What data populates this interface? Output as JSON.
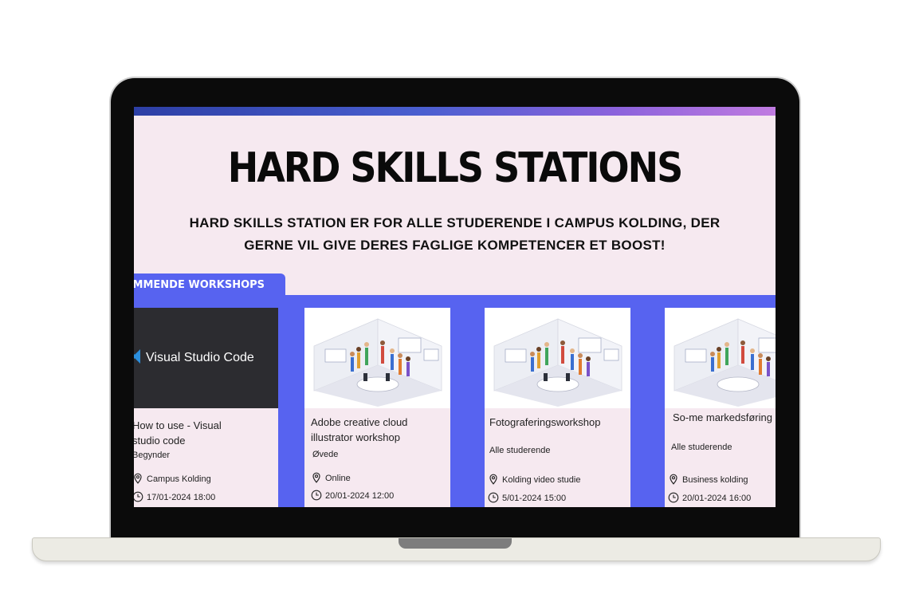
{
  "header": {
    "title": "HARD SKILLS STATIONS",
    "subtitle": "HARD SKILLS STATION ER FOR ALLE STUDERENDE I CAMPUS KOLDING, DER GERNE VIL GIVE DERES FAGLIGE KOMPETENCER ET BOOST!"
  },
  "tab": {
    "label": "KOMMENDE WORKSHOPS"
  },
  "colors": {
    "accent": "#5763f0",
    "background": "#f6e9f0",
    "gradient_start": "#2d3fa5",
    "gradient_end": "#c07be0"
  },
  "workshops": [
    {
      "image_label": "Visual Studio Code",
      "title": "How to use - Visual studio code",
      "level": "Begynder",
      "location": "Campus Kolding",
      "datetime": "17/01-2024 18:00",
      "location_icon": "location-pin-icon",
      "time_icon": "clock-icon"
    },
    {
      "title": "Adobe creative cloud illustrator workshop",
      "level": "Øvede",
      "location": "Online",
      "datetime": "20/01-2024 12:00",
      "location_icon": "location-pin-icon",
      "time_icon": "clock-icon"
    },
    {
      "title": "Fotograferingsworkshop",
      "level": "Alle studerende",
      "location": "Kolding video studie",
      "datetime": "5/01-2024 15:00",
      "location_icon": "location-pin-icon",
      "time_icon": "clock-icon"
    },
    {
      "title": "So-me markedsføring",
      "level": "Alle studerende",
      "location": "Business kolding",
      "datetime": "20/01-2024 16:00",
      "location_icon": "location-pin-icon",
      "time_icon": "clock-icon"
    }
  ]
}
